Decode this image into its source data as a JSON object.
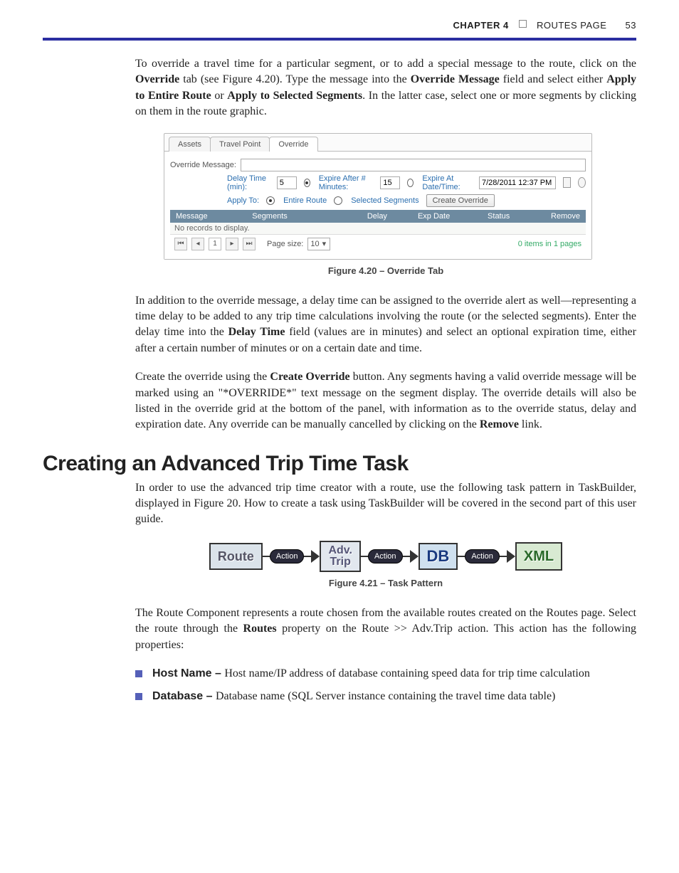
{
  "header": {
    "chapter": "CHAPTER 4",
    "title": "ROUTES PAGE",
    "page_number": "53"
  },
  "p1_a": "To override a travel time for a particular segment, or to add a special message to the route, click on the ",
  "p1_b": "Override",
  "p1_c": " tab (see Figure 4.20). Type the message into the ",
  "p1_d": "Override Message",
  "p1_e": " field and select either ",
  "p1_f": "Apply to Entire Route",
  "p1_g": " or ",
  "p1_h": "Apply to Selected Segments",
  "p1_i": ". In the latter case, select one or more segments by clicking on them in the route graphic.",
  "fig20": {
    "tabs": {
      "assets": "Assets",
      "travel": "Travel Point",
      "override": "Override"
    },
    "override_msg_label": "Override Message:",
    "override_msg_value": "",
    "delay_label": "Delay Time (min):",
    "delay_value": "5",
    "exp_min_label": "Expire After # Minutes:",
    "exp_min_value": "15",
    "exp_dt_label": "Expire At Date/Time:",
    "exp_dt_value": "7/28/2011 12:37 PM",
    "apply_label": "Apply To:",
    "apply_entire": "Entire Route",
    "apply_selected": "Selected Segments",
    "create_btn": "Create Override",
    "cols": {
      "msg": "Message",
      "seg": "Segments",
      "delay": "Delay",
      "exp": "Exp Date",
      "status": "Status",
      "remove": "Remove"
    },
    "empty": "No records to display.",
    "page_current": "1",
    "page_size_label": "Page size:",
    "page_size_value": "10",
    "pager_summary": "0 items in 1 pages"
  },
  "fig20_caption": "Figure 4.20 – Override Tab",
  "p2_a": "In addition to the override message, a delay time can be assigned to the override alert as well—representing a time delay to be added to any trip time calculations involving the route (or the selected segments). Enter the delay time into the ",
  "p2_b": "Delay Time",
  "p2_c": " field (values are in minutes) and select an optional expiration time, either after a certain number of minutes or on a certain date and time.",
  "p3_a": "Create the override using the ",
  "p3_b": "Create Override",
  "p3_c": " button. Any segments having a valid override message will be marked using an \"*OVERRIDE*\" text message on the segment display. The override details will also be listed in the override grid at the bottom of the panel, with information as to the override status, delay and expiration date. Any override can be manually cancelled by clicking on the ",
  "p3_d": "Remove",
  "p3_e": " link.",
  "section_heading": "Creating an Advanced Trip Time Task",
  "p4": "In order to use the advanced trip time creator with a route, use the following task pattern in TaskBuilder, displayed in Figure 20.  How to create a task using TaskBuilder will be covered in the second part of this user guide.",
  "tp": {
    "route": "Route",
    "action": "Action",
    "adv1": "Adv.",
    "adv2": "Trip",
    "db": "DB",
    "xml": "XML"
  },
  "fig21_caption": "Figure 4.21 – Task Pattern",
  "p5_a": "The Route Component represents a route chosen from the available routes created on the Routes page. Select the route through the ",
  "p5_b": "Routes",
  "p5_c": " property on the Route >> Adv.Trip action. This action has the following properties:",
  "props": [
    {
      "label": "Host Name – ",
      "text": "Host name/IP address of database containing speed data for trip time calculation"
    },
    {
      "label": "Database – ",
      "text": "Database name (SQL Server instance containing the travel time data table)"
    }
  ]
}
